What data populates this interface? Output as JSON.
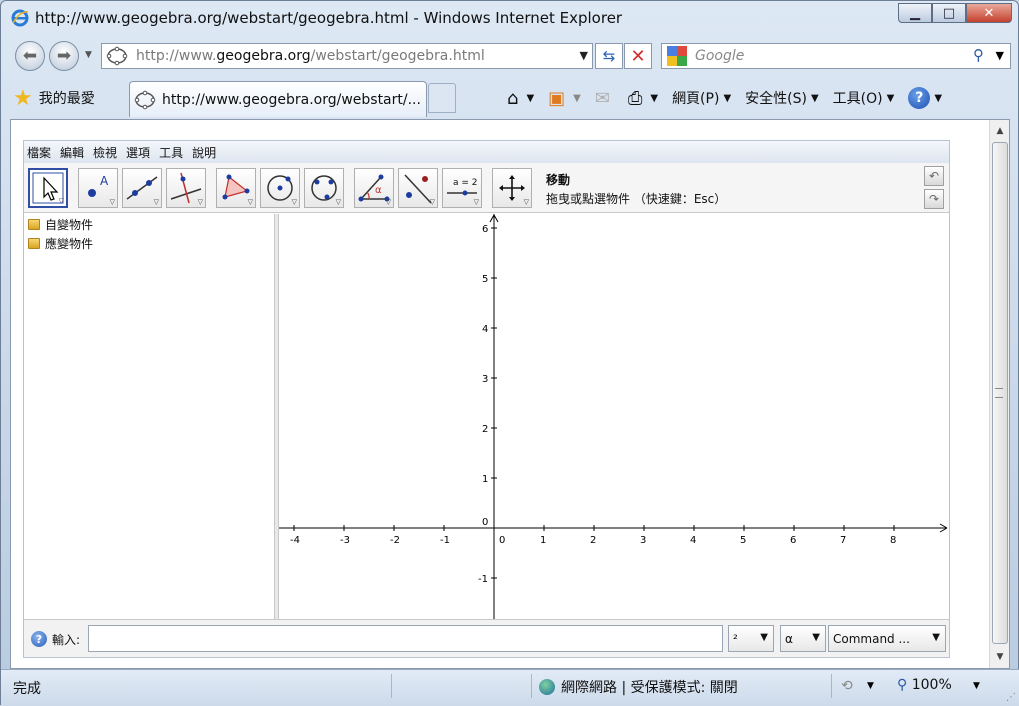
{
  "window": {
    "title": "http://www.geogebra.org/webstart/geogebra.html - Windows Internet Explorer",
    "min_glyph": "▁",
    "max_glyph": "□",
    "close_glyph": "✕"
  },
  "address_bar": {
    "url_gray_prefix": "http://www.",
    "url_domain": "geogebra.org",
    "url_gray_suffix": "/webstart/geogebra.html",
    "search_placeholder": "Google"
  },
  "command_bar": {
    "favorites_label": "我的最愛",
    "tab_label": "http://www.geogebra.org/webstart/...",
    "page_menu": "網頁(P)",
    "safety_menu": "安全性(S)",
    "tools_menu": "工具(O)",
    "help_glyph": "?"
  },
  "geogebra": {
    "menu": [
      "檔案",
      "編輯",
      "檢視",
      "選項",
      "工具",
      "說明"
    ],
    "tools": [
      {
        "name": "move-tool",
        "selected": true
      },
      {
        "name": "point-tool"
      },
      {
        "name": "line-tool"
      },
      {
        "name": "perpendicular-tool"
      },
      {
        "name": "polygon-tool"
      },
      {
        "name": "circle-tool"
      },
      {
        "name": "conic-tool"
      },
      {
        "name": "angle-tool"
      },
      {
        "name": "reflect-tool"
      },
      {
        "name": "slider-tool"
      },
      {
        "name": "move-view-tool"
      }
    ],
    "slider_tool_text": "a = 2",
    "angle_tool_text": "α",
    "selected_tool_name": "移動",
    "selected_tool_help": "拖曳或點選物件 （快速鍵：Esc）",
    "algebra_folders": [
      "自變物件",
      "應變物件"
    ],
    "graphics": {
      "x_ticks": [
        -4,
        -3,
        -2,
        -1,
        0,
        1,
        2,
        3,
        4,
        5,
        6,
        7,
        8
      ],
      "y_ticks": [
        -1,
        0,
        1,
        2,
        3,
        4,
        5,
        6
      ]
    },
    "input": {
      "label": "輸入:",
      "value": "",
      "help_glyph": "?",
      "superscript_combo": "²",
      "greek_combo": "α",
      "command_combo": "Command ..."
    }
  },
  "status_bar": {
    "status_text": "完成",
    "zone_text": "網際網路 | 受保護模式: 關閉",
    "zoom_text": "100%"
  }
}
